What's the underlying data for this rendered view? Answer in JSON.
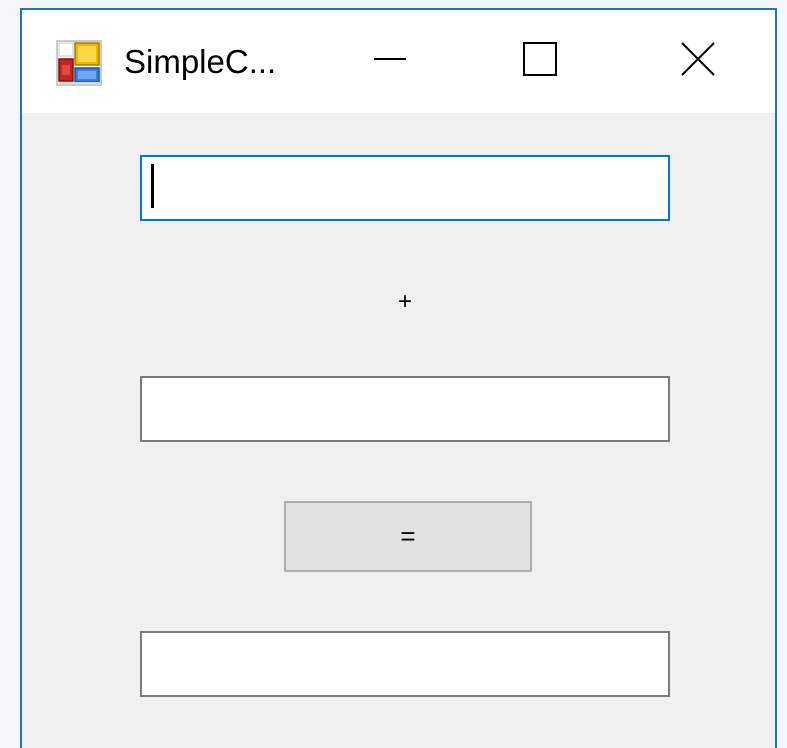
{
  "window": {
    "title": "SimpleC...",
    "controls": {
      "minimize_icon": "minimize-icon",
      "maximize_icon": "maximize-icon",
      "close_icon": "close-icon"
    },
    "accent_color": "#1f72c5"
  },
  "form": {
    "first_operand": {
      "value": "",
      "focused": true
    },
    "operator_label": "+",
    "second_operand": {
      "value": ""
    },
    "equals_button_label": "=",
    "result": {
      "value": ""
    }
  }
}
